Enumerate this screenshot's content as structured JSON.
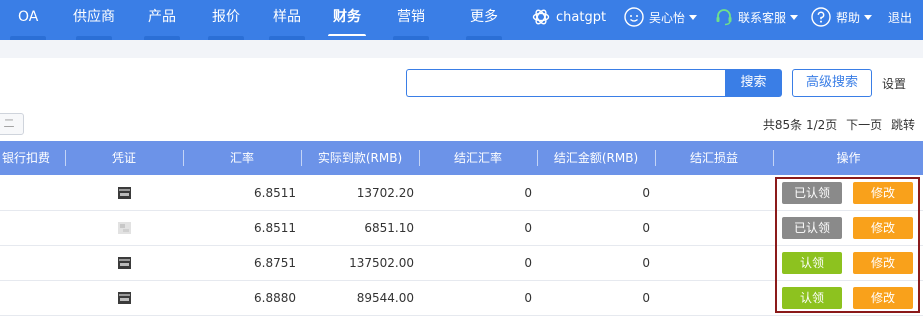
{
  "nav": {
    "items": [
      {
        "label": "OA"
      },
      {
        "label": "供应商"
      },
      {
        "label": "产品"
      },
      {
        "label": "报价"
      },
      {
        "label": "样品"
      },
      {
        "label": "财务",
        "active": true
      },
      {
        "label": "营销"
      },
      {
        "label": "更多"
      }
    ],
    "chatgpt_label": "chatgpt",
    "user_name": "吴心怡",
    "support_label": "联系客服",
    "help_label": "帮助",
    "logout_label": "退出"
  },
  "search": {
    "value": "",
    "placeholder": "",
    "search_label": "搜索",
    "advanced_label": "高级搜索",
    "settings_label": "设置"
  },
  "toolbar": {
    "small_button_label": "二"
  },
  "pagination": {
    "summary": "共85条 1/2页",
    "next_label": "下一页",
    "jump_label": "跳转"
  },
  "table": {
    "headers": {
      "bank_fee": "银行扣费",
      "voucher": "凭证",
      "rate": "汇率",
      "received": "实际到款(RMB)",
      "settle_rate": "结汇汇率",
      "settle_amount": "结汇金额(RMB)",
      "settle_gain": "结汇损益",
      "actions": "操作"
    },
    "rows": [
      {
        "voucher_icon": "voucher-thumbnail-icon",
        "rate": "6.8511",
        "received": "13702.20",
        "settle_rate": "0",
        "settle_amount": "0",
        "claim_label": "已认领",
        "claimed": true,
        "edit_label": "修改"
      },
      {
        "voucher_icon": "voucher-thumbnail-faded-icon",
        "rate": "6.8511",
        "received": "6851.10",
        "settle_rate": "0",
        "settle_amount": "0",
        "claim_label": "已认领",
        "claimed": true,
        "edit_label": "修改"
      },
      {
        "voucher_icon": "voucher-thumbnail-icon",
        "rate": "6.8751",
        "received": "137502.00",
        "settle_rate": "0",
        "settle_amount": "0",
        "claim_label": "认领",
        "claimed": false,
        "edit_label": "修改"
      },
      {
        "voucher_icon": "voucher-thumbnail-icon",
        "rate": "6.8880",
        "received": "89544.00",
        "settle_rate": "0",
        "settle_amount": "0",
        "claim_label": "认领",
        "claimed": false,
        "edit_label": "修改"
      }
    ]
  },
  "colors": {
    "nav_bg": "#3a7ee6",
    "header_bg": "#6c93e8",
    "claimed_btn": "#8a8a8a",
    "claim_btn": "#8dc21f",
    "edit_btn": "#f9a11b",
    "highlight_frame": "#8b1a1a"
  }
}
